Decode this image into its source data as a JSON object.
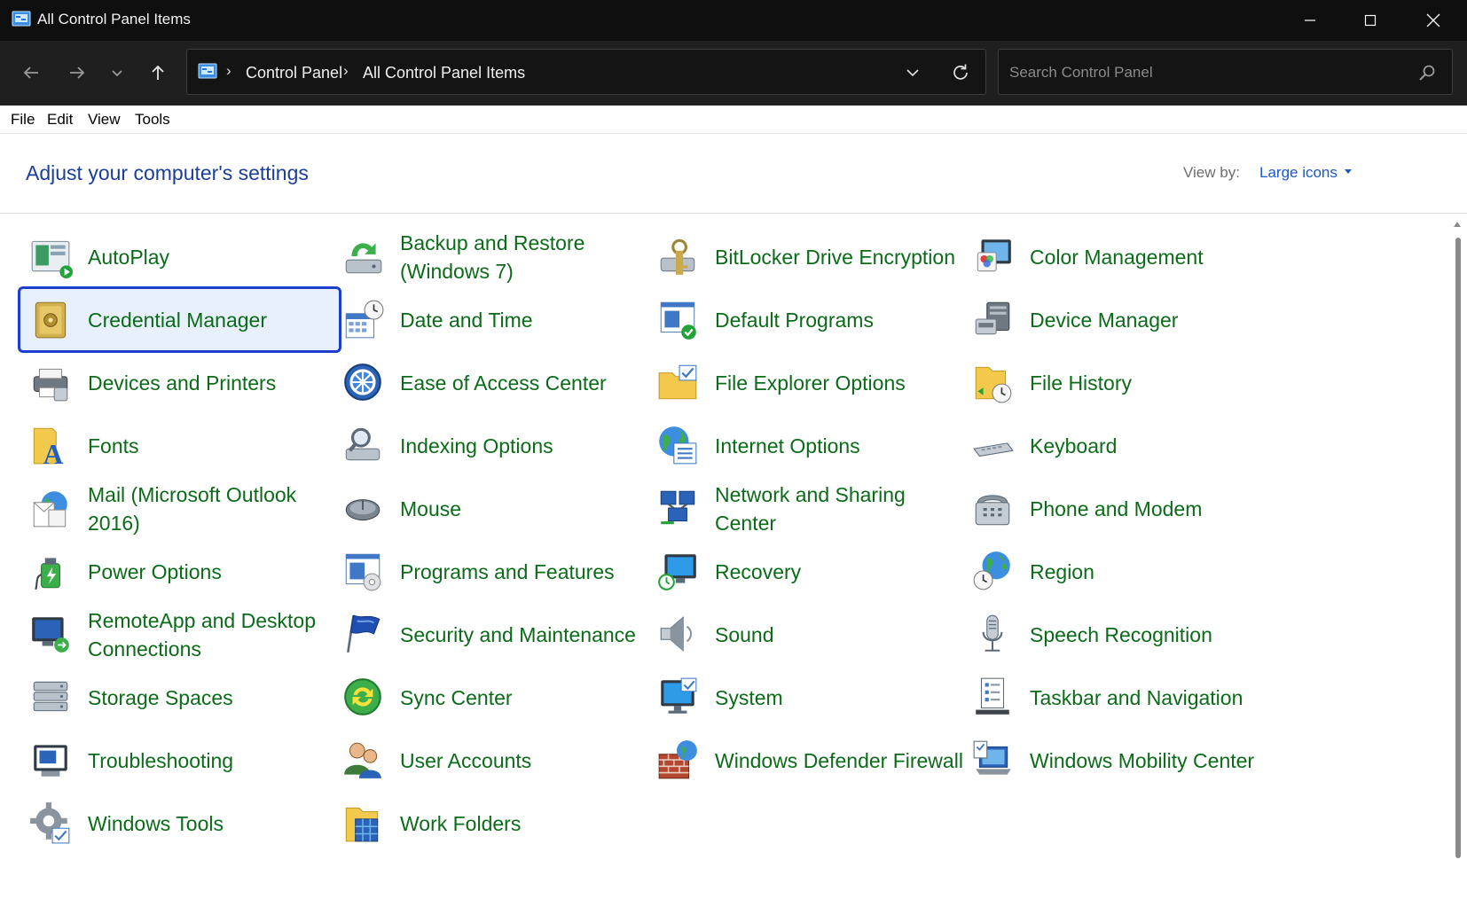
{
  "window": {
    "title": "All Control Panel Items",
    "controls": [
      "minimize",
      "maximize",
      "close"
    ]
  },
  "nav": {
    "breadcrumb": [
      "Control Panel",
      "All Control Panel Items"
    ],
    "separator": "›",
    "search_placeholder": "Search Control Panel"
  },
  "menu": {
    "items": [
      "File",
      "Edit",
      "View",
      "Tools"
    ]
  },
  "header": {
    "title": "Adjust your computer's settings",
    "view_by_label": "View by:",
    "view_by_value": "Large icons"
  },
  "colors": {
    "item_text": "#0b6b18",
    "title_text": "#1a3e9a",
    "link": "#1d58c7",
    "selection_border": "#1d3fcf",
    "selection_fill": "#e7f0fc"
  },
  "items": [
    {
      "label": "AutoPlay",
      "icon": "autoplay-icon"
    },
    {
      "label": "Backup and Restore (Windows 7)",
      "icon": "backup-restore-icon"
    },
    {
      "label": "BitLocker Drive Encryption",
      "icon": "bitlocker-icon"
    },
    {
      "label": "Color Management",
      "icon": "color-management-icon"
    },
    {
      "label": "Credential Manager",
      "icon": "credential-manager-icon",
      "selected": true
    },
    {
      "label": "Date and Time",
      "icon": "date-time-icon"
    },
    {
      "label": "Default Programs",
      "icon": "default-programs-icon"
    },
    {
      "label": "Device Manager",
      "icon": "device-manager-icon"
    },
    {
      "label": "Devices and Printers",
      "icon": "devices-printers-icon"
    },
    {
      "label": "Ease of Access Center",
      "icon": "ease-of-access-icon"
    },
    {
      "label": "File Explorer Options",
      "icon": "file-explorer-options-icon"
    },
    {
      "label": "File History",
      "icon": "file-history-icon"
    },
    {
      "label": "Fonts",
      "icon": "fonts-icon"
    },
    {
      "label": "Indexing Options",
      "icon": "indexing-options-icon"
    },
    {
      "label": "Internet Options",
      "icon": "internet-options-icon"
    },
    {
      "label": "Keyboard",
      "icon": "keyboard-icon"
    },
    {
      "label": "Mail (Microsoft Outlook 2016)",
      "icon": "mail-icon"
    },
    {
      "label": "Mouse",
      "icon": "mouse-icon"
    },
    {
      "label": "Network and Sharing Center",
      "icon": "network-sharing-icon"
    },
    {
      "label": "Phone and Modem",
      "icon": "phone-modem-icon"
    },
    {
      "label": "Power Options",
      "icon": "power-options-icon"
    },
    {
      "label": "Programs and Features",
      "icon": "programs-features-icon"
    },
    {
      "label": "Recovery",
      "icon": "recovery-icon"
    },
    {
      "label": "Region",
      "icon": "region-icon"
    },
    {
      "label": "RemoteApp and Desktop Connections",
      "icon": "remoteapp-icon"
    },
    {
      "label": "Security and Maintenance",
      "icon": "security-maintenance-icon"
    },
    {
      "label": "Sound",
      "icon": "sound-icon"
    },
    {
      "label": "Speech Recognition",
      "icon": "speech-recognition-icon"
    },
    {
      "label": "Storage Spaces",
      "icon": "storage-spaces-icon"
    },
    {
      "label": "Sync Center",
      "icon": "sync-center-icon"
    },
    {
      "label": "System",
      "icon": "system-icon"
    },
    {
      "label": "Taskbar and Navigation",
      "icon": "taskbar-navigation-icon"
    },
    {
      "label": "Troubleshooting",
      "icon": "troubleshooting-icon"
    },
    {
      "label": "User Accounts",
      "icon": "user-accounts-icon"
    },
    {
      "label": "Windows Defender Firewall",
      "icon": "firewall-icon"
    },
    {
      "label": "Windows Mobility Center",
      "icon": "mobility-center-icon"
    },
    {
      "label": "Windows Tools",
      "icon": "windows-tools-icon"
    },
    {
      "label": "Work Folders",
      "icon": "work-folders-icon"
    }
  ]
}
